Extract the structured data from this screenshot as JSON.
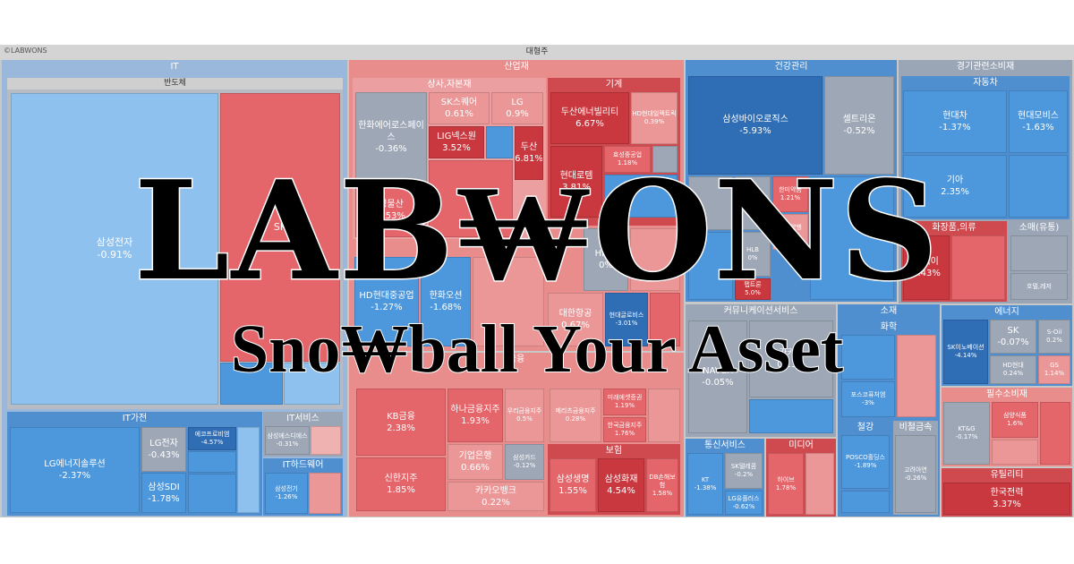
{
  "copyright": "©LABWONS",
  "header": "대형주",
  "sectors": {
    "it": "IT",
    "semis": "반도체",
    "it_appliance": "IT가전",
    "it_service": "IT서비스",
    "it_hardware": "IT하드웨어",
    "industrial": "산업재",
    "trading": "상사,자본재",
    "machinery": "기계",
    "healthcare": "건강관리",
    "consumer_disc": "경기관련소비재",
    "auto": "자동차",
    "cosmetics": "화장품,의류",
    "retail": "소매(유통)",
    "comm_services": "커뮤니케이션서비스",
    "materials": "소재",
    "chemicals": "화학",
    "steel": "철강",
    "nonferrous": "비철금속",
    "energy": "에너지",
    "finance": "금융",
    "insurance": "보험",
    "telecom": "통신서비스",
    "media": "미디어",
    "staples": "필수소비재",
    "utilities": "유틸리티"
  },
  "tiles": {
    "samsung_elec": {
      "name": "삼성전자",
      "pct": "-0.91%"
    },
    "sk_hynix": {
      "name": "SK",
      "pct": ""
    },
    "lg_energy": {
      "name": "LG에너지솔루션",
      "pct": "-2.37%"
    },
    "lg_elec": {
      "name": "LG전자",
      "pct": "-0.43%"
    },
    "samsung_sdi": {
      "name": "삼성SDI",
      "pct": "-1.78%"
    },
    "ecopro": {
      "name": "에코프로비엠",
      "pct": "-4.57%"
    },
    "samsung_em": {
      "name": "삼성전기",
      "pct": "-1.26%"
    },
    "samsung_sds": {
      "name": "삼성에스디에스",
      "pct": "-0.31%"
    },
    "sk_square": {
      "name": "SK스퀘어",
      "pct": "0.61%"
    },
    "lg": {
      "name": "LG",
      "pct": "0.9%"
    },
    "hanwha_aero": {
      "name": "한화에어로스페이스",
      "pct": "-0.36%"
    },
    "lig": {
      "name": "LIG넥스원",
      "pct": "3.52%"
    },
    "doosan": {
      "name": "두산",
      "pct": "6.81%"
    },
    "doosan_enb": {
      "name": "두산에너빌리티",
      "pct": "6.67%"
    },
    "hyosung": {
      "name": "효성중공업",
      "pct": "1.18%"
    },
    "hd_hyundai_elec": {
      "name": "HD현대일렉트릭",
      "pct": "0.39%"
    },
    "hyundai_rotem": {
      "name": "현대로템",
      "pct": "3.81%"
    },
    "samsung_ct": {
      "name": "성물산",
      "pct": "1.53%"
    },
    "hd_heavy": {
      "name": "HD현대중공업",
      "pct": "-1.27%"
    },
    "hanwha_ocean": {
      "name": "한화오션",
      "pct": "-1.68%"
    },
    "hmm": {
      "name": "HMM",
      "pct": "0%"
    },
    "korean_air": {
      "name": "대한항공",
      "pct": "0.67%"
    },
    "hyundai_glovis": {
      "name": "현대글로비스",
      "pct": "-3.01%"
    },
    "samsung_bio": {
      "name": "삼성바이오로직스",
      "pct": "-5.93%"
    },
    "celltrion": {
      "name": "셀트리온",
      "pct": "-0.52%"
    },
    "sk_biopharm": {
      "name": "SK바이오팜",
      "pct": "-0.44%"
    },
    "hanmi": {
      "name": "한미약품",
      "pct": "1.21%"
    },
    "yuhan": {
      "name": "유한양행",
      "pct": "0.98%"
    },
    "hlb": {
      "name": "HLB",
      "pct": "0%"
    },
    "pepton": {
      "name": "펩트론",
      "pct": "5.0%"
    },
    "hyundai_motor": {
      "name": "현대차",
      "pct": "-1.37%"
    },
    "hyundai_mobis": {
      "name": "현대모비스",
      "pct": "-1.63%"
    },
    "kia": {
      "name": "기아",
      "pct": "2.35%"
    },
    "kolmar": {
      "name": "코웨이",
      "pct": "5.43%"
    },
    "hotel": {
      "name": "호텔,레저",
      "pct": ""
    },
    "naver": {
      "name": "NAVER",
      "pct": "-0.05%"
    },
    "kakao": {
      "name": "카카오",
      "pct": "0.13%"
    },
    "posco_hold": {
      "name": "POSCO홀딩스",
      "pct": "-1.89%"
    },
    "korea_zinc": {
      "name": "고려아연",
      "pct": "-0.26%"
    },
    "posco_future": {
      "name": "포스코퓨처엠",
      "pct": "-3%"
    },
    "sk_inno": {
      "name": "SK이노베이션",
      "pct": "-4.14%"
    },
    "sk": {
      "name": "SK",
      "pct": "-0.07%"
    },
    "s_oil": {
      "name": "S-Oil",
      "pct": "0.2%"
    },
    "hd_hyundai": {
      "name": "HD현대",
      "pct": "0.24%"
    },
    "gs": {
      "name": "GS",
      "pct": "1.14%"
    },
    "kb": {
      "name": "KB금융",
      "pct": "2.38%"
    },
    "shinhan": {
      "name": "신한지주",
      "pct": "1.85%"
    },
    "hana": {
      "name": "하나금융지주",
      "pct": "1.93%"
    },
    "woori": {
      "name": "우리금융지주",
      "pct": "0.5%"
    },
    "ibk": {
      "name": "기업은행",
      "pct": "0.66%"
    },
    "kakaobank": {
      "name": "카카오뱅크",
      "pct": "0.22%"
    },
    "samsung_card": {
      "name": "삼성카드",
      "pct": "-0.12%"
    },
    "meritz": {
      "name": "메리츠금융지주",
      "pct": "0.28%"
    },
    "mirae": {
      "name": "미래에셋증권",
      "pct": "1.19%"
    },
    "korea_inv": {
      "name": "한국금융지주",
      "pct": "1.76%"
    },
    "samsung_life": {
      "name": "삼성생명",
      "pct": "1.55%"
    },
    "samsung_fire": {
      "name": "삼성화재",
      "pct": "4.54%"
    },
    "db_ins": {
      "name": "DB손해보험",
      "pct": "1.58%"
    },
    "kt": {
      "name": "KT",
      "pct": "-1.38%"
    },
    "sk_telecom": {
      "name": "SK텔레콤",
      "pct": "-0.2%"
    },
    "lg_uplus": {
      "name": "LG유플러스",
      "pct": "-0.62%"
    },
    "hybe": {
      "name": "하이브",
      "pct": "1.78%"
    },
    "ktg": {
      "name": "KT&G",
      "pct": "-0.17%"
    },
    "samyang": {
      "name": "삼양식품",
      "pct": "1.6%"
    },
    "kepco": {
      "name": "한국전력",
      "pct": "3.37%"
    }
  },
  "logo": {
    "title": "LAB₩ONS",
    "slogan": "Sno₩ball Your Asset"
  }
}
